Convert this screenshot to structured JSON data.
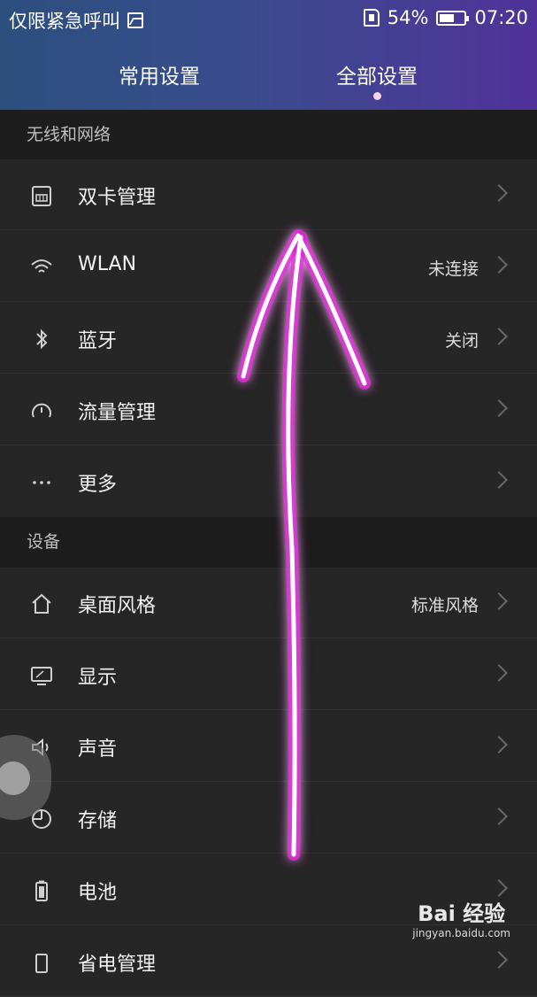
{
  "status_bar": {
    "carrier": "仅限紧急呼叫",
    "battery": "54%",
    "time": "07:20"
  },
  "tabs": [
    {
      "label": "常用设置"
    },
    {
      "label": "全部设置"
    }
  ],
  "sections": [
    {
      "title": "无线和网络",
      "items": [
        {
          "label": "双卡管理",
          "value": "",
          "icon": "sim-card-icon"
        },
        {
          "label": "WLAN",
          "value": "未连接",
          "icon": "wifi-icon"
        },
        {
          "label": "蓝牙",
          "value": "关闭",
          "icon": "bluetooth-icon"
        },
        {
          "label": "流量管理",
          "value": "",
          "icon": "data-usage-icon"
        },
        {
          "label": "更多",
          "value": "",
          "icon": "more-icon"
        }
      ]
    },
    {
      "title": "设备",
      "items": [
        {
          "label": "桌面风格",
          "value": "标准风格",
          "icon": "home-icon"
        },
        {
          "label": "显示",
          "value": "",
          "icon": "display-icon"
        },
        {
          "label": "声音",
          "value": "",
          "icon": "sound-icon"
        },
        {
          "label": "存储",
          "value": "",
          "icon": "storage-icon"
        },
        {
          "label": "电池",
          "value": "",
          "icon": "battery-icon"
        },
        {
          "label": "省电管理",
          "value": "",
          "icon": "power-saving-icon"
        }
      ]
    }
  ],
  "watermark": {
    "logo": "Bai 经验",
    "url": "jingyan.baidu.com"
  },
  "colors": {
    "header_gradient_start": "#2c4f7e",
    "header_gradient_end": "#50329a",
    "background": "#262626",
    "arrow_glow": "#e01fd8"
  }
}
